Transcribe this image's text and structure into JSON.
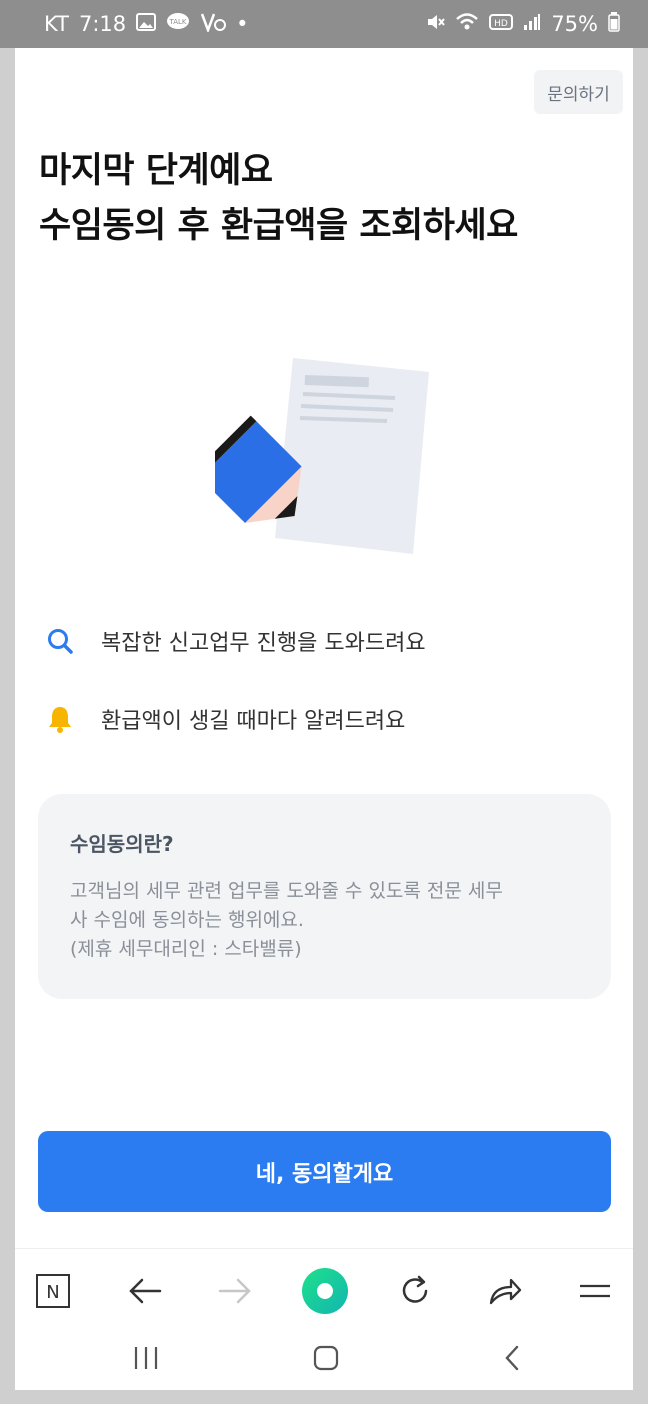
{
  "status": {
    "carrier": "KT",
    "time": "7:18",
    "battery": "75%",
    "dot": "•"
  },
  "header": {
    "help_label": "문의하기"
  },
  "title": {
    "line1": "마지막 단계예요",
    "line2": "수임동의 후 환급액을 조회하세요"
  },
  "features": [
    {
      "icon": "search-icon",
      "text": "복잡한 신고업무 진행을 도와드려요"
    },
    {
      "icon": "bell-icon",
      "text": "환급액이 생길 때마다 알려드려요"
    }
  ],
  "info": {
    "title": "수임동의란?",
    "line1": "고객님의 세무 관련 업무를 도와줄 수 있도록 전문 세무",
    "line2": "사 수임에 동의하는 행위에요.",
    "line3": "(제휴 세무대리인 : 스타밸류)"
  },
  "cta": {
    "label": "네, 동의할게요"
  },
  "browser": {
    "home_label": "N"
  },
  "colors": {
    "accent": "#2b7cf0",
    "bell": "#f7b500",
    "search": "#2b7cf0",
    "green": "#19c37d"
  }
}
